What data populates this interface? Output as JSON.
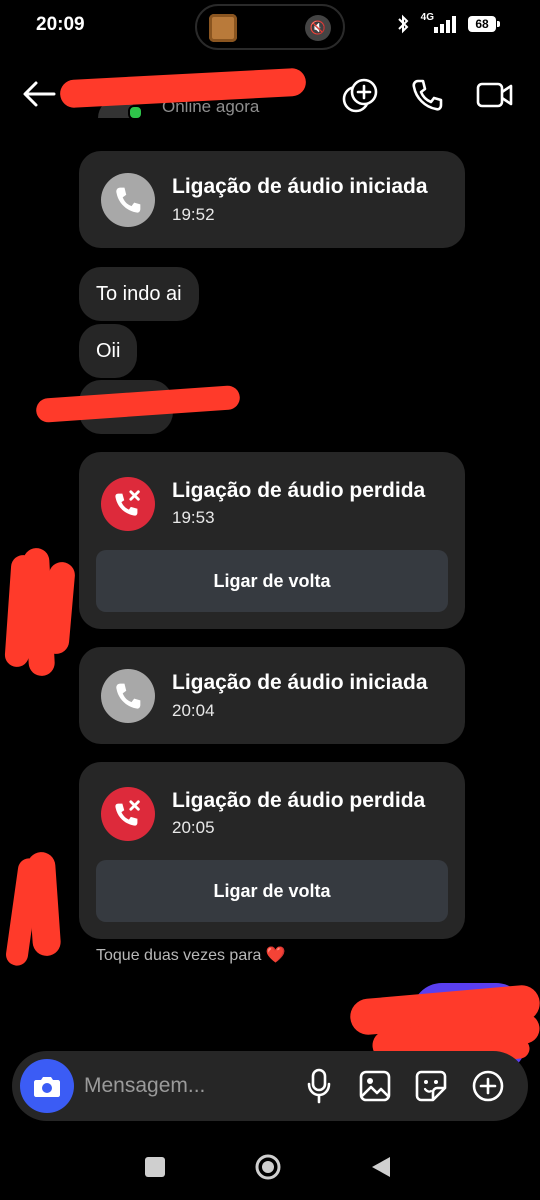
{
  "status_bar": {
    "time": "20:09",
    "network": "4G",
    "battery": "68"
  },
  "header": {
    "subtitle": "Online agora"
  },
  "messages": {
    "call1": {
      "title": "Ligação de áudio iniciada",
      "time": "19:52"
    },
    "bubble1": "To indo ai",
    "bubble2": "Oii",
    "call2": {
      "title": "Ligação de áudio perdida",
      "time": "19:53",
      "button": "Ligar de volta"
    },
    "call3": {
      "title": "Ligação de áudio iniciada",
      "time": "20:04"
    },
    "call4": {
      "title": "Ligação de áudio perdida",
      "time": "20:05",
      "button": "Ligar de volta"
    }
  },
  "hint": "Toque duas vezes para ❤️",
  "composer": {
    "placeholder": "Mensagem..."
  },
  "colors": {
    "missed_red": "#dd2a3b",
    "camera_blue": "#3b5cf5",
    "card_bg": "#262626",
    "redaction": "#ff3a2a"
  },
  "icons": [
    "back-arrow-icon",
    "sticker-add-icon",
    "phone-icon",
    "video-camera-icon",
    "camera-icon",
    "microphone-icon",
    "image-icon",
    "sticker-icon",
    "plus-icon"
  ]
}
